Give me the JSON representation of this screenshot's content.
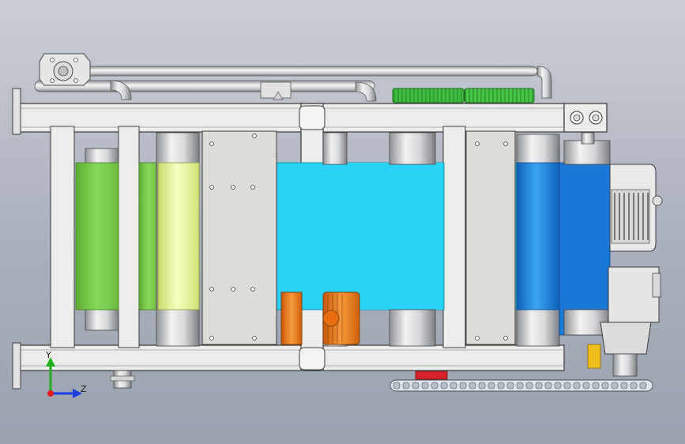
{
  "triad": {
    "y_label": "Y",
    "z_label": "Z",
    "y_color": "#1fb01f",
    "z_color": "#1b3fe0",
    "x_color": "#e01b1b"
  },
  "colors": {
    "frame": "#e9e9e6",
    "frame_edge": "#3a3a3a",
    "green_roller": "#7fcf4f",
    "yellow_roller": "#e8f59a",
    "cyan_belt": "#29d2f5",
    "blue_roller": "#1a78d8",
    "orange_motor": "#f07a15",
    "gear_green": "#3fbf3f",
    "chain": "#c9d2dc"
  }
}
